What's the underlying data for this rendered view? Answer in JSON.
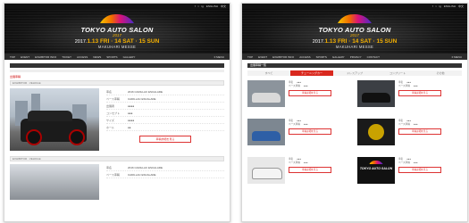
{
  "header": {
    "top_links": [
      "f",
      "t",
      "ig",
      "ENGLISH",
      "中文"
    ],
    "logo_text": "TOKYO AUTO SALON",
    "logo_year": "2017",
    "dates_prefix": "2017.",
    "dates": "1.13 FRI · 14 SAT · 15 SUN",
    "venue": "MAKUHARI MESSE"
  },
  "nav": {
    "items": [
      "TOP",
      "EVENT",
      "EXHIBITOR INFO",
      "TICKET",
      "ACCESS",
      "NEWS",
      "SPORTS",
      "GALLERY",
      "MEDIA",
      "PRIVACY",
      "CONTACT"
    ],
    "right": "≡ MENU"
  },
  "left": {
    "section_label": "TOP",
    "red_label": "出展車輌",
    "sub_label": "EXHIBITOR · VEHICLE",
    "spec_rows": [
      {
        "k": "車名",
        "v": "2016 CADILLAC ESCALADE"
      },
      {
        "k": "ベース車輌",
        "v": "CADILLAC ESCALADE"
      },
      {
        "k": "出展者",
        "v": "●●●●"
      },
      {
        "k": "コンセプト",
        "v": "●●●"
      },
      {
        "k": "サイズ",
        "v": "●●●●"
      },
      {
        "k": "ホール",
        "v": "●●"
      }
    ],
    "detail_label": "車輌詳細を見る",
    "sub_label_2": "EXHIBITOR · VEHICLE"
  },
  "right": {
    "list_title": "出展車輌一覧",
    "tabs": [
      "すべて",
      "チューニングカー",
      "ドレスアップ",
      "コンプリート",
      "その他"
    ],
    "active_tab": 1,
    "cards": [
      {
        "name": "●●●",
        "base": "●●●",
        "btn": "車輌詳細を見る"
      },
      {
        "name": "●●●",
        "base": "●●●",
        "btn": "車輌詳細を見る"
      },
      {
        "name": "●●●",
        "base": "●●●",
        "btn": "車輌詳細を見る"
      },
      {
        "name": "●●●",
        "base": "●●●",
        "btn": "車輌詳細を見る"
      },
      {
        "name": "●●●",
        "base": "●●●",
        "btn": "車輌詳細を見る"
      },
      {
        "name": "●●●",
        "base": "●●●",
        "btn": "車輌詳細を見る"
      }
    ],
    "card_logos": [
      "",
      "",
      "",
      "",
      "",
      "TOKYO AUTO SALON"
    ]
  },
  "colors": {
    "accent": "#d9281e",
    "dark": "#111111",
    "gold": "#f4b000"
  }
}
